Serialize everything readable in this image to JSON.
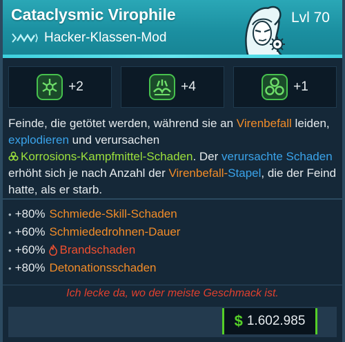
{
  "item": {
    "name": "Cataclysmic Virophile",
    "class": "Hacker-Klassen-Mod",
    "level": "Lvl 70"
  },
  "skills": [
    {
      "icon": "skill-ice-icon",
      "value": "+2"
    },
    {
      "icon": "skill-wave-icon",
      "value": "+4"
    },
    {
      "icon": "skill-triad-icon",
      "value": "+1"
    }
  ],
  "description": {
    "p1": "Feinde, die getötet werden, während sie an ",
    "virenbefall1": "Virenbefall",
    "p2": " leiden, ",
    "explodieren": "explodieren",
    "p3": " und verursachen ",
    "korrosion": "Korrosions-Kampfmittel-Schaden",
    "p4": ". Der ",
    "verursachte": "verursachte Schaden",
    "p5": " erhöht sich je nach Anzahl der ",
    "virenbefall2": "Virenbefall-",
    "stapel": "Stapel",
    "p6": ", die der Feind hatte, als er starb."
  },
  "bonuses": [
    {
      "value": "+80%",
      "label": "Schmiede-Skill-Schaden"
    },
    {
      "value": "+60%",
      "label": "Schmiededrohnen-Dauer"
    },
    {
      "value": "+60%",
      "label": "Brandschaden"
    },
    {
      "value": "+80%",
      "label": "Detonationsschaden"
    }
  ],
  "flavor": "Ich lecke da, wo der meiste Geschmack ist.",
  "price": {
    "currency": "$",
    "amount": "1.602.985"
  },
  "colors": {
    "header": "#1b8fa0",
    "orange": "#f28c28",
    "blue": "#3aa3ea",
    "green": "#9ce03c",
    "red": "#e0402e",
    "money": "#55d028"
  }
}
